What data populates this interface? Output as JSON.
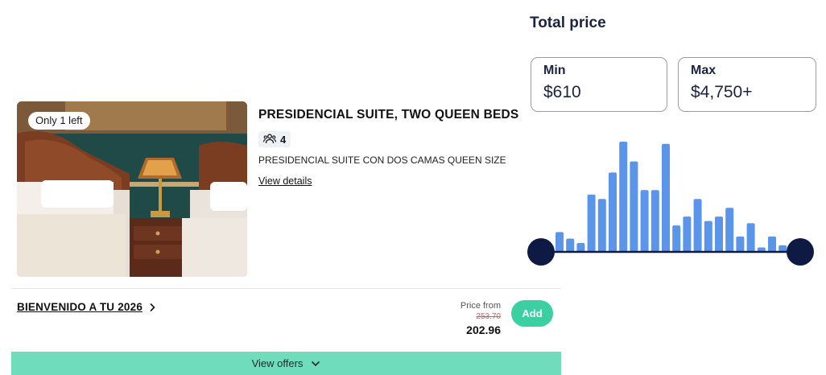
{
  "room": {
    "badge": "Only 1 left",
    "title": "PRESIDENCIAL SUITE, TWO QUEEN BEDS",
    "occupancy": "4",
    "subtitle": "PRESIDENCIAL SUITE CON DOS CAMAS QUEEN SIZE",
    "details_link": "View details",
    "icons": {
      "occupancy": "people-icon"
    }
  },
  "rate": {
    "name": "BIENVENIDO A TU 2026",
    "price_from_label": "Price from",
    "original_price": "253.70",
    "price": "202.96",
    "add_label": "Add"
  },
  "offers_bar": {
    "label": "View offers"
  },
  "price_filter": {
    "title": "Total price",
    "min_label": "Min",
    "min_value": "$610",
    "max_label": "Max",
    "max_value": "$4,750+",
    "histogram": [
      9,
      6,
      4,
      26,
      24,
      36,
      50,
      41,
      28,
      28,
      49,
      12,
      16,
      24,
      14,
      16,
      20,
      7,
      13,
      2,
      7,
      3
    ],
    "colors": {
      "bar": "#5b95ea",
      "track": "#0f1a44",
      "accent": "#3ccfa2"
    }
  }
}
